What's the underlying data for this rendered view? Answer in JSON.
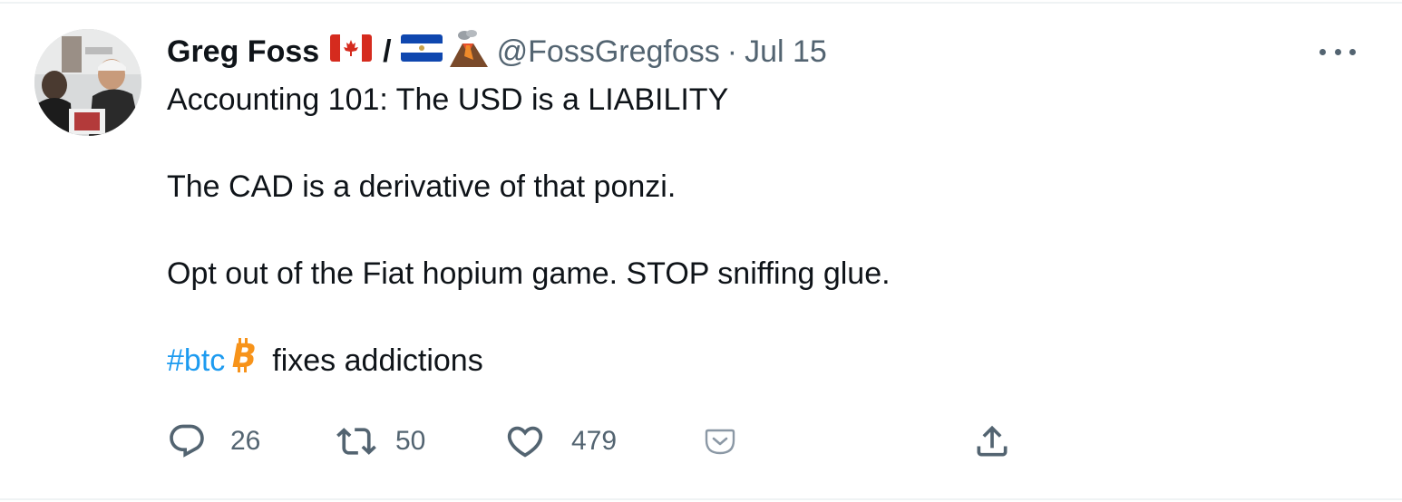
{
  "tweet": {
    "author": {
      "display_name": "Greg Foss",
      "slash": "/",
      "handle": "@FossGregfoss",
      "separator": "·",
      "date": "Jul 15",
      "flags": [
        "canada-flag-icon",
        "el-salvador-flag-icon",
        "volcano-icon"
      ]
    },
    "text": {
      "line1": "Accounting 101:  The USD is a LIABILITY",
      "line2": "The CAD is a derivative of that ponzi.",
      "line3": "Opt out of the Fiat hopium game.  STOP sniffing glue.",
      "hashtag": "#btc",
      "line4_rest": "fixes addictions"
    },
    "actions": {
      "replies": "26",
      "retweets": "50",
      "likes": "479"
    }
  },
  "colors": {
    "text": "#0f1419",
    "secondary": "#536471",
    "link": "#1d9bf0",
    "bitcoin": "#f7931a",
    "border": "#eff3f4"
  }
}
